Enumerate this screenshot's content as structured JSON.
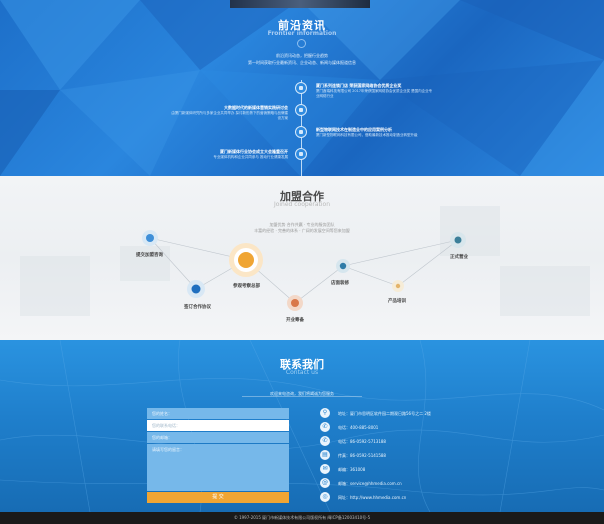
{
  "news": {
    "title": "前沿资讯",
    "subtitle": "Frontier information",
    "intro": [
      "前沿资讯动态，把握行业趋势",
      "第一时间获取行业最新资讯、企业动态、新闻与媒体报道信息"
    ],
    "items": [
      {
        "title": "厦门系列连锁门店 荣获国家网络协会优质企业奖",
        "desc": "厦门鑫瑞科技有限公司 2017年荣获国家网络协会优质企业奖 是国内企业专业网络行业"
      },
      {
        "title": "大数据时代的新媒体营销实践研讨会",
        "desc": "由厦门新媒体研究所与多家企业共同举办 探讨新形势下的营销策略与品牌建设方案"
      },
      {
        "title": "新型物联网技术在制造业中的应用案例分析",
        "desc": "厦门新型物联网科技有限公司，借助最新技术推动制造业转型升级"
      },
      {
        "title": "厦门新媒体行业协会成立大会隆重召开",
        "desc": "专业媒体机构和企业共同参与 推动行业健康发展"
      }
    ]
  },
  "coop": {
    "title": "加盟合作",
    "subtitle": "Joined cooperation",
    "intro": [
      "加盟优势 合作共赢 · 专业的服务团队",
      "丰富的经验 · 完善的体系 · 广阔的发展空间等您来加盟"
    ],
    "nodes": [
      {
        "label": "提交加盟咨询"
      },
      {
        "label": "签订合作协议"
      },
      {
        "label": "参观考察总部"
      },
      {
        "label": "开业筹备"
      },
      {
        "label": "正式营业"
      },
      {
        "label": "产品培训"
      },
      {
        "label": "店面装修"
      }
    ]
  },
  "contact": {
    "title": "联系我们",
    "subtitle": "Contact us",
    "intro": "欢迎来电咨询，我们将竭诚为您服务",
    "form": {
      "name_placeholder": "您的姓名：",
      "phone_placeholder": "您的联系电话：",
      "email_placeholder": "您的邮箱：",
      "message_placeholder": "请填写您的留言：",
      "submit_label": "提 交"
    },
    "info": [
      {
        "icon": "location-icon",
        "text": "地址：厦门市思明区软件园二期观日路56号之二 2楼"
      },
      {
        "icon": "phone-icon",
        "text": "电话：400-885-8001"
      },
      {
        "icon": "phone-icon",
        "text": "电话：86-0592-5713188"
      },
      {
        "icon": "fax-icon",
        "text": "传真：86-0592-5141588"
      },
      {
        "icon": "mail-icon",
        "text": "邮编：361008"
      },
      {
        "icon": "email-icon",
        "text": "邮箱：service@hhmedia.com.cn"
      },
      {
        "icon": "web-icon",
        "text": "网址：http://www.hhmedia.com.cn"
      }
    ]
  },
  "footer": {
    "text": "© 1997-2015 厦门市新媒体技术有限公司版权所有    闽ICP备12003410号-5"
  },
  "colors": {
    "news_blue": "#2a86de",
    "contact_blue": "#1f7fcc",
    "submit_orange": "#f0a533",
    "node_orange": "#f0a533",
    "node_blue": "#3f8fd8"
  }
}
